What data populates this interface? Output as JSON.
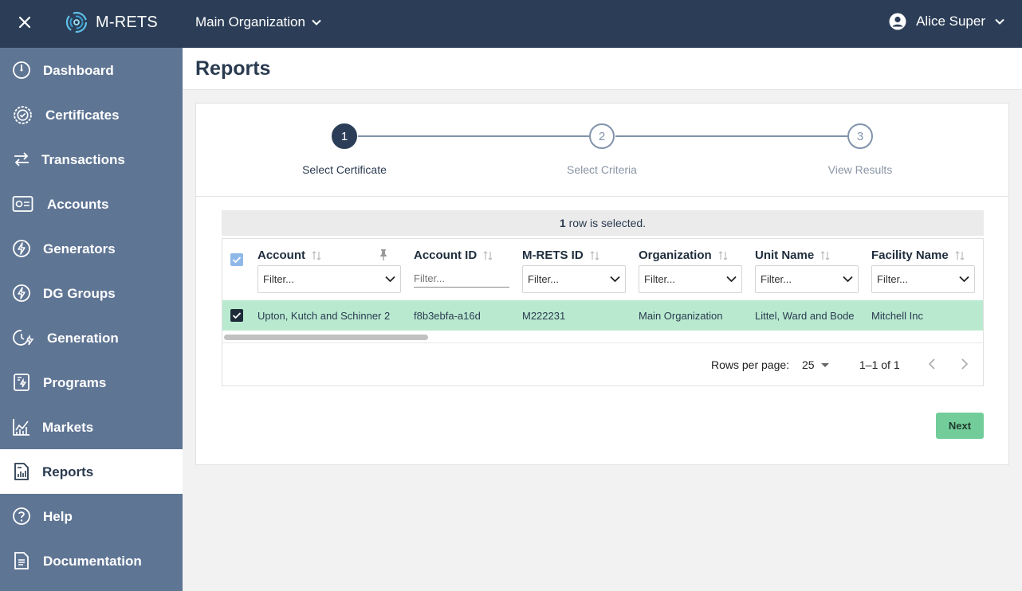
{
  "topbar": {
    "brand": "M-RETS",
    "organization": "Main Organization",
    "user": "Alice Super"
  },
  "sidebar": {
    "items": [
      {
        "label": "Dashboard",
        "icon": "dashboard-gauge-icon"
      },
      {
        "label": "Certificates",
        "icon": "certificate-badge-icon"
      },
      {
        "label": "Transactions",
        "icon": "transfer-arrows-icon"
      },
      {
        "label": "Accounts",
        "icon": "account-card-icon"
      },
      {
        "label": "Generators",
        "icon": "lightning-bolt-icon"
      },
      {
        "label": "DG Groups",
        "icon": "lightning-bolt-icon"
      },
      {
        "label": "Generation",
        "icon": "clock-bolt-icon"
      },
      {
        "label": "Programs",
        "icon": "document-bolt-icon"
      },
      {
        "label": "Markets",
        "icon": "line-chart-icon"
      },
      {
        "label": "Reports",
        "icon": "report-chart-icon"
      },
      {
        "label": "Help",
        "icon": "question-circle-icon"
      },
      {
        "label": "Documentation",
        "icon": "document-icon"
      }
    ],
    "active": "Reports"
  },
  "page": {
    "title": "Reports"
  },
  "stepper": {
    "steps": [
      {
        "number": "1",
        "label": "Select Certificate"
      },
      {
        "number": "2",
        "label": "Select Criteria"
      },
      {
        "number": "3",
        "label": "View Results"
      }
    ],
    "active_step": 1
  },
  "selection": {
    "count": "1",
    "text": " row is selected."
  },
  "table": {
    "columns": [
      {
        "header": "Account",
        "filter": "Filter..."
      },
      {
        "header": "Account ID",
        "filter": "Filter..."
      },
      {
        "header": "M-RETS ID",
        "filter": "Filter..."
      },
      {
        "header": "Organization",
        "filter": "Filter..."
      },
      {
        "header": "Unit Name",
        "filter": "Filter..."
      },
      {
        "header": "Facility Name",
        "filter": "Filter..."
      }
    ],
    "rows": [
      [
        "Upton, Kutch and Schinner 2",
        "f8b3ebfa-a16d",
        "M222231",
        "Main Organization",
        "Littel, Ward and Bode",
        "Mitchell Inc"
      ]
    ]
  },
  "pagination": {
    "rows_per_page_label": "Rows per page:",
    "rows_per_page": "25",
    "range": "1–1 of 1"
  },
  "actions": {
    "next": "Next"
  },
  "colors": {
    "topbar": "#2c3e57",
    "sidebar": "#5f7594",
    "selected_row": "#b9ead0",
    "next_button": "#73cd9b"
  }
}
